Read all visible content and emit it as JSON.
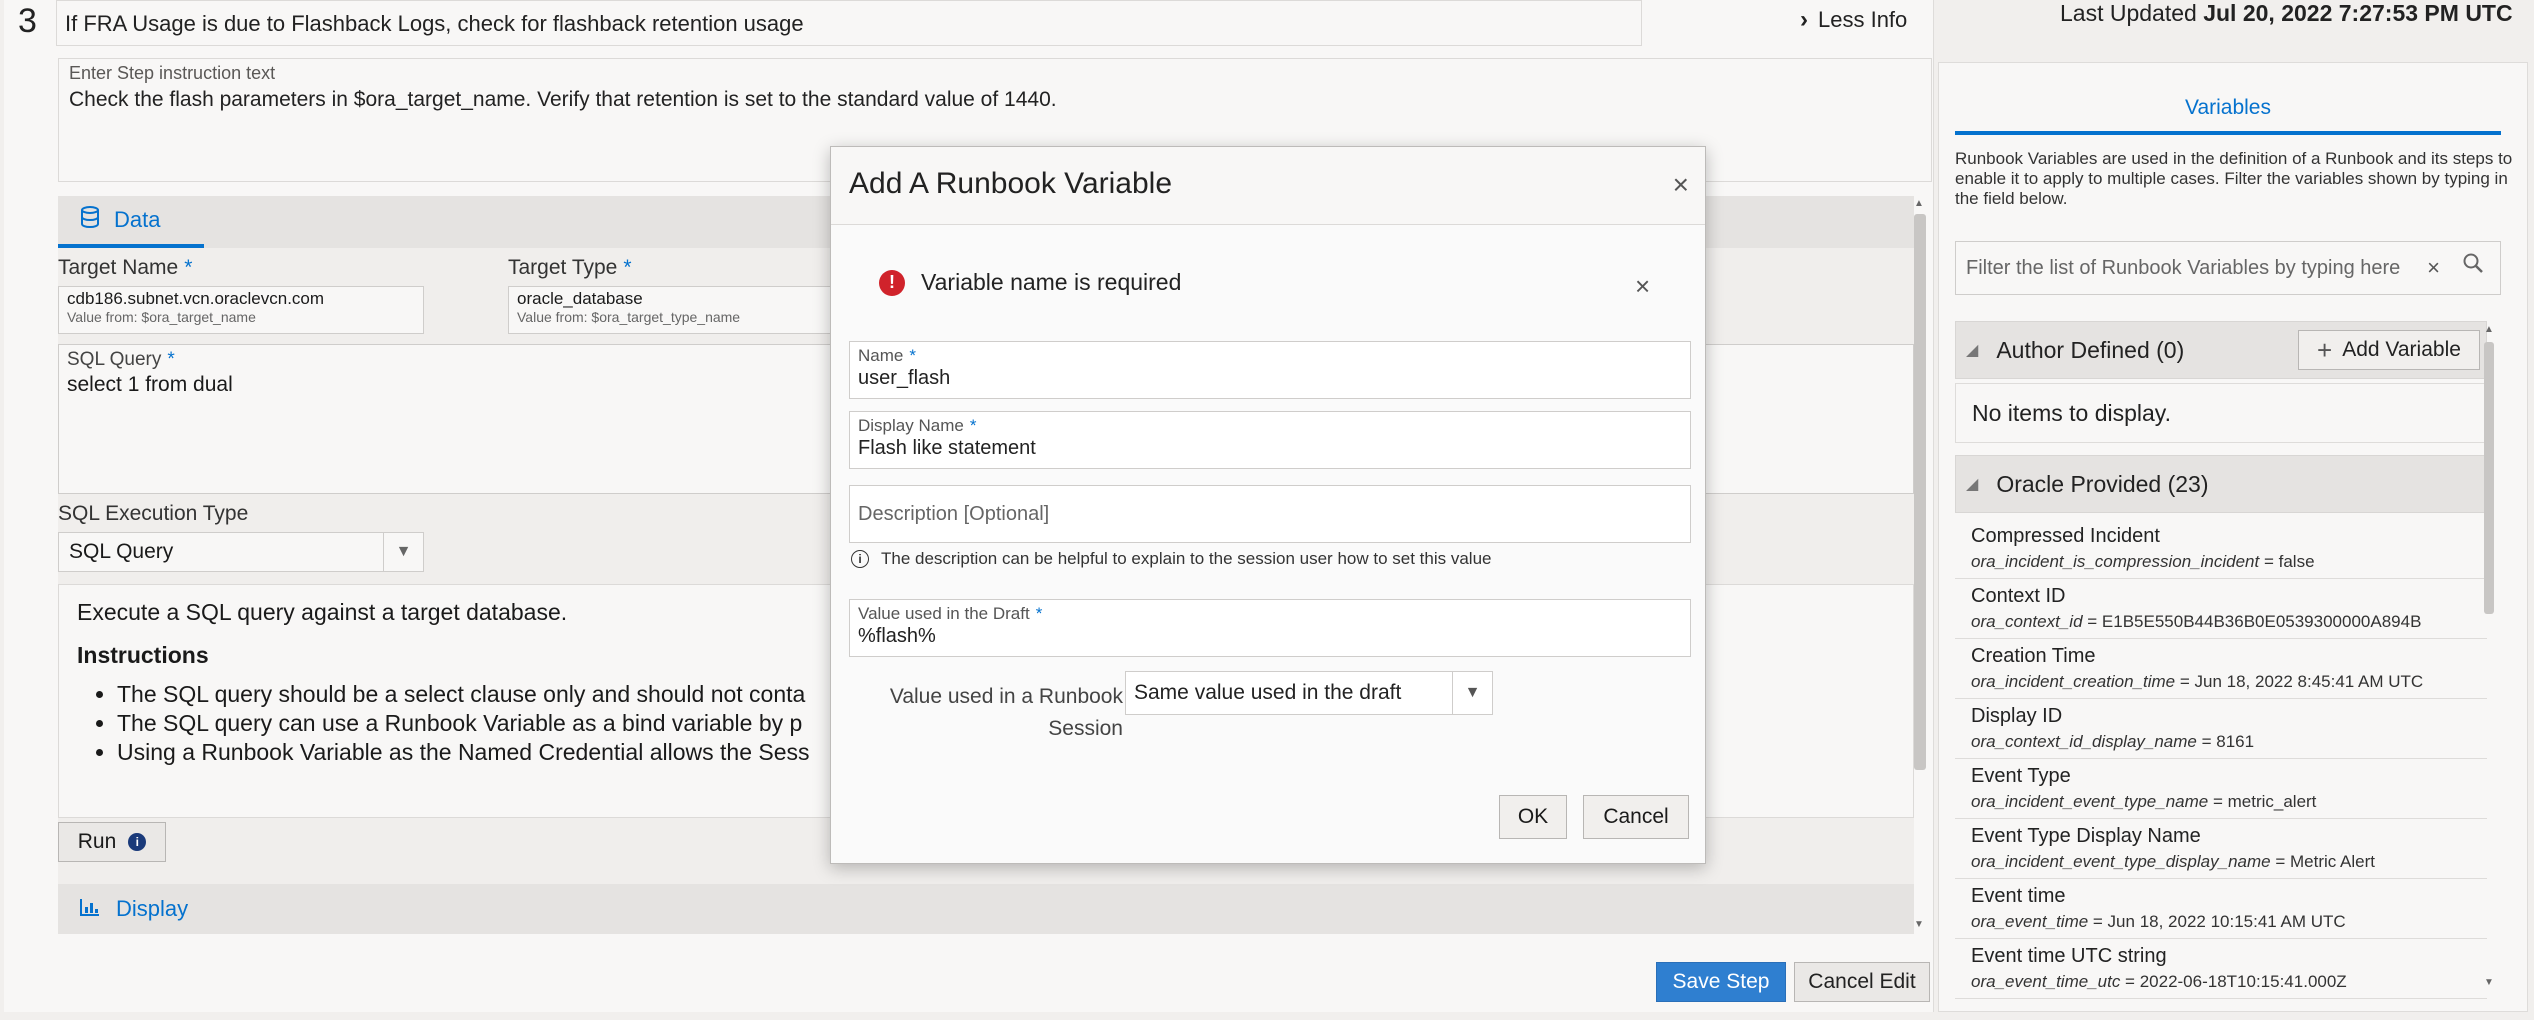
{
  "step": {
    "number": "3",
    "title": "If FRA Usage is due to Flashback Logs, check for flashback retention usage",
    "less_info": "Less Info",
    "instruction_label": "Enter Step instruction text",
    "instruction_text": "Check the flash parameters in $ora_target_name. Verify that retention is set to the standard value of 1440."
  },
  "data_tab": {
    "label": "Data"
  },
  "target": {
    "name_label": "Target Name",
    "name_value": "cdb186.subnet.vcn.oraclevcn.com",
    "name_hint": "Value from: $ora_target_name",
    "type_label": "Target Type",
    "type_value": "oracle_database",
    "type_hint": "Value from: $ora_target_type_name"
  },
  "sql": {
    "label": "SQL Query",
    "value": "select 1 from dual",
    "exec_type_label": "SQL Execution Type",
    "exec_type_value": "SQL Query"
  },
  "description_panel": {
    "intro": "Execute a SQL query against a target database.",
    "heading": "Instructions",
    "bullets": [
      "The SQL query should be a select clause only and should not conta",
      "The SQL query can use a Runbook Variable as a bind variable by p",
      "Using a Runbook Variable as the Named Credential allows the Sess"
    ]
  },
  "run_button": "Run",
  "display_tab": "Display",
  "footer": {
    "save_step": "Save Step",
    "cancel_edit": "Cancel Edit"
  },
  "right_panel": {
    "last_updated_label": "Last Updated",
    "last_updated_value": "Jul 20, 2022 7:27:53 PM UTC",
    "tab": "Variables",
    "description": "Runbook Variables are used in the definition of a Runbook and its steps to enable it to apply to multiple cases. Filter the variables shown by typing in the field below.",
    "filter_placeholder": "Filter the list of Runbook Variables by typing here",
    "author_defined": "Author Defined (0)",
    "add_variable": "Add Variable",
    "no_items": "No items to display.",
    "oracle_provided": "Oracle Provided (23)",
    "variables": [
      {
        "name": "Compressed Incident",
        "key": "ora_incident_is_compression_incident",
        "value": " = false"
      },
      {
        "name": "Context ID",
        "key": "ora_context_id",
        "value": " = E1B5E550B44B36B0E0539300000A894B"
      },
      {
        "name": "Creation Time",
        "key": "ora_incident_creation_time",
        "value": " = Jun 18, 2022 8:45:41 AM UTC"
      },
      {
        "name": "Display ID",
        "key": "ora_context_id_display_name",
        "value": " = 8161"
      },
      {
        "name": "Event Type",
        "key": "ora_incident_event_type_name",
        "value": " = metric_alert"
      },
      {
        "name": "Event Type Display Name",
        "key": "ora_incident_event_type_display_name",
        "value": " = Metric Alert"
      },
      {
        "name": "Event time",
        "key": "ora_event_time",
        "value": " = Jun 18, 2022 10:15:41 AM UTC"
      },
      {
        "name": "Event time UTC string",
        "key": "ora_event_time_utc",
        "value": " = 2022-06-18T10:15:41.000Z"
      }
    ]
  },
  "modal": {
    "title": "Add A Runbook Variable",
    "error": "Variable name is required",
    "name_label": "Name",
    "name_value": "user_flash",
    "display_name_label": "Display Name",
    "display_name_value": "Flash like statement",
    "description_placeholder": "Description [Optional]",
    "description_hint": "The description can be helpful to explain to the session user how to set this value",
    "draft_value_label": "Value used in the Draft",
    "draft_value": "%flash%",
    "session_label_line1": "Value used in a Runbook",
    "session_label_line2": "Session",
    "session_value": "Same value used in the draft",
    "ok": "OK",
    "cancel": "Cancel"
  }
}
